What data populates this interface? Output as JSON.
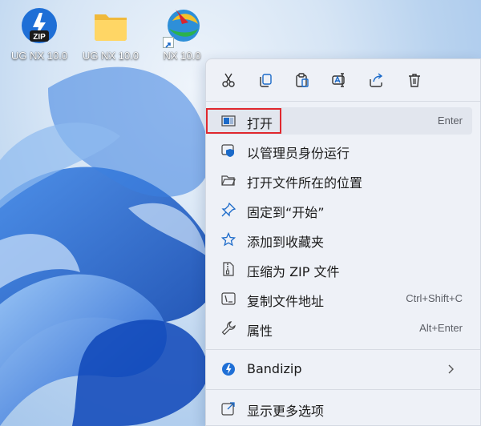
{
  "desktop_icons": [
    {
      "label": "UG NX 10.0",
      "icon": "zip-archive-icon",
      "badge": "ZIP"
    },
    {
      "label": "UG NX 10.0",
      "icon": "folder-icon"
    },
    {
      "label": "NX 10.0",
      "icon": "nx-app-shortcut-icon"
    }
  ],
  "toolbar": {
    "buttons": [
      "cut-icon",
      "copy-icon",
      "paste-icon",
      "rename-icon",
      "share-icon",
      "delete-icon"
    ]
  },
  "menu": {
    "items": [
      {
        "label": "打开",
        "shortcut": "Enter",
        "icon": "open-window-icon"
      },
      {
        "label": "以管理员身份运行",
        "shortcut": "",
        "icon": "shield-icon"
      },
      {
        "label": "打开文件所在的位置",
        "shortcut": "",
        "icon": "folder-open-icon"
      },
      {
        "label": "固定到“开始”",
        "shortcut": "",
        "icon": "pin-icon"
      },
      {
        "label": "添加到收藏夹",
        "shortcut": "",
        "icon": "star-icon"
      },
      {
        "label": "压缩为 ZIP 文件",
        "shortcut": "",
        "icon": "zip-file-icon"
      },
      {
        "label": "复制文件地址",
        "shortcut": "Ctrl+Shift+C",
        "icon": "copy-path-icon"
      },
      {
        "label": "属性",
        "shortcut": "Alt+Enter",
        "icon": "wrench-icon"
      },
      {
        "label": "Bandizip",
        "shortcut": "",
        "icon": "bandizip-icon"
      },
      {
        "label": "显示更多选项",
        "shortcut": "",
        "icon": "more-options-icon"
      }
    ]
  },
  "colors": {
    "accent": "#1b6ac9",
    "highlight_box": "#e0282e",
    "menu_bg": "#eef1f7"
  }
}
